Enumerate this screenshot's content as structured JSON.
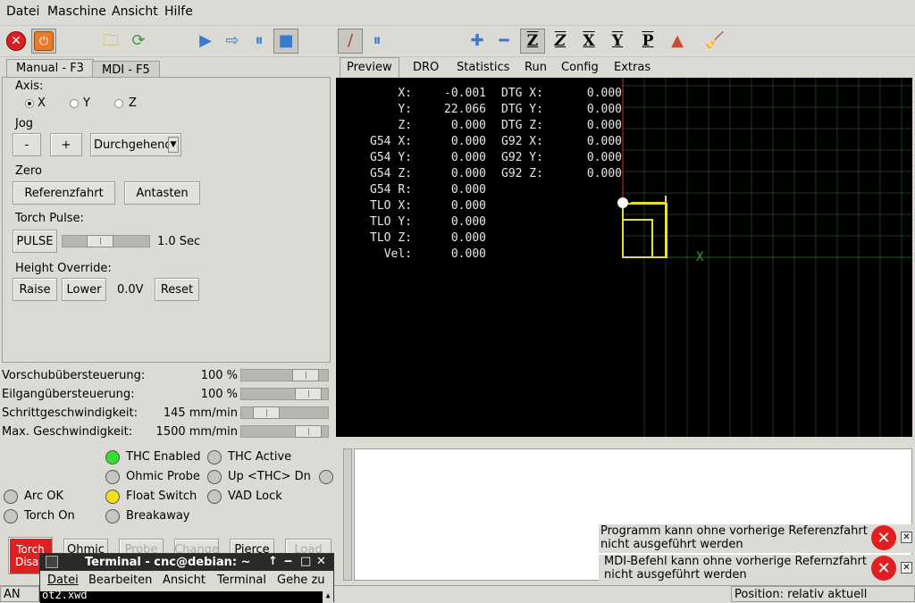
{
  "menubar": {
    "items": [
      "Datei",
      "Maschine",
      "Ansicht",
      "Hilfe"
    ],
    "underline_first": [
      "D",
      "M",
      "A",
      "H"
    ]
  },
  "toolbar": {
    "icons": [
      "estop-icon",
      "machine-power-icon",
      "open-file-icon",
      "reload-icon",
      "run-icon",
      "step-icon",
      "pause-icon",
      "stop-icon",
      "block-delete-icon",
      "optional-stop-icon",
      "zoom-in-icon",
      "zoom-out-icon",
      "view-z-icon",
      "view-z2-icon",
      "view-x-icon",
      "view-y-icon",
      "view-p-icon",
      "rotate-view-icon",
      "clear-plot-icon"
    ],
    "view_labels": [
      "Z",
      "Z",
      "X",
      "Y",
      "P"
    ]
  },
  "left_tabs": [
    "Manual - F3",
    "MDI - F5"
  ],
  "manual": {
    "axis_label": "Axis:",
    "axes": [
      "X",
      "Y",
      "Z"
    ],
    "selected_axis": "X",
    "jog_label": "Jog",
    "jog_minus": "-",
    "jog_plus": "+",
    "jog_mode": "Durchgehend",
    "zero_label": "Zero",
    "home_button": "Referenzfahrt",
    "touch_off_button": "Antasten",
    "torch_pulse_label": "Torch Pulse:",
    "pulse_button": "PULSE",
    "pulse_value": "1.0 Sec",
    "pulse_fraction": 0.4,
    "height_override_label": "Height Override:",
    "raise_button": "Raise",
    "lower_button": "Lower",
    "override_value": "0.0V",
    "reset_button": "Reset"
  },
  "overrides": [
    {
      "label": "Vorschubübersteuerung:",
      "value": "100 %",
      "fraction": 0.85
    },
    {
      "label": "Eilgangübersteuerung:",
      "value": "100 %",
      "fraction": 0.9
    },
    {
      "label": "Schrittgeschwindigkeit:",
      "value": "145 mm/min",
      "fraction": 0.2
    },
    {
      "label": "Max. Geschwindigkeit:",
      "value": "1500 mm/min",
      "fraction": 0.9
    }
  ],
  "right_tabs": [
    "Preview",
    "DRO",
    "Statistics",
    "Run",
    "Config",
    "Extras"
  ],
  "dro_left": [
    {
      "label": "X:",
      "value": "-0.001"
    },
    {
      "label": "Y:",
      "value": "22.066"
    },
    {
      "label": "Z:",
      "value": "0.000"
    },
    {
      "label": "G54 X:",
      "value": "0.000"
    },
    {
      "label": "G54 Y:",
      "value": "0.000"
    },
    {
      "label": "G54 Z:",
      "value": "0.000"
    },
    {
      "label": "G54 R:",
      "value": "0.000"
    },
    {
      "label": "TLO X:",
      "value": "0.000"
    },
    {
      "label": "TLO Y:",
      "value": "0.000"
    },
    {
      "label": "TLO Z:",
      "value": "0.000"
    },
    {
      "label": "Vel:",
      "value": "0.000"
    }
  ],
  "dro_right": [
    {
      "label": "DTG X:",
      "value": "0.000"
    },
    {
      "label": "DTG Y:",
      "value": "0.000"
    },
    {
      "label": "DTG Z:",
      "value": "0.000"
    },
    {
      "label": "G92 X:",
      "value": "0.000"
    },
    {
      "label": "G92 Y:",
      "value": "0.000"
    },
    {
      "label": "G92 Z:",
      "value": "0.000"
    }
  ],
  "preview_axis_label": "X",
  "leds": [
    {
      "label": "THC Enabled",
      "color": "#33dd33"
    },
    {
      "label": "THC Active",
      "color": "#c8c6c0"
    },
    {
      "label": "Ohmic Probe",
      "color": "#c8c6c0"
    },
    {
      "label": "Up <THC> Dn",
      "color": "#c8c6c0"
    },
    {
      "label": "Arc OK",
      "color": "#c8c6c0"
    },
    {
      "label": "Float Switch",
      "color": "#f0e020"
    },
    {
      "label": "VAD Lock",
      "color": "#c8c6c0"
    },
    {
      "label": "Torch On",
      "color": "#c8c6c0"
    },
    {
      "label": "Breakaway",
      "color": "#c8c6c0"
    }
  ],
  "bottom_buttons": [
    "Torch Disab",
    "Ohmic",
    "Probe",
    "Change",
    "Pierce",
    "Load"
  ],
  "torch_button_color": "#e02020",
  "notifications": [
    {
      "line1": "Programm kann ohne vorherige Referenzfahrt",
      "line2": "nicht ausgeführt werden"
    },
    {
      "line1": "MDI-Befehl kann ohne vorherige Refernzfahrt",
      "line2": "nicht ausgeführt werden"
    }
  ],
  "statusbar": {
    "left": "AN",
    "right": "Position: relativ aktuell"
  },
  "terminal": {
    "title": "Terminal - cnc@debian: ~",
    "menu": [
      "Datei",
      "Bearbeiten",
      "Ansicht",
      "Terminal",
      "Gehe zu"
    ],
    "content": "ot2.xwd"
  }
}
